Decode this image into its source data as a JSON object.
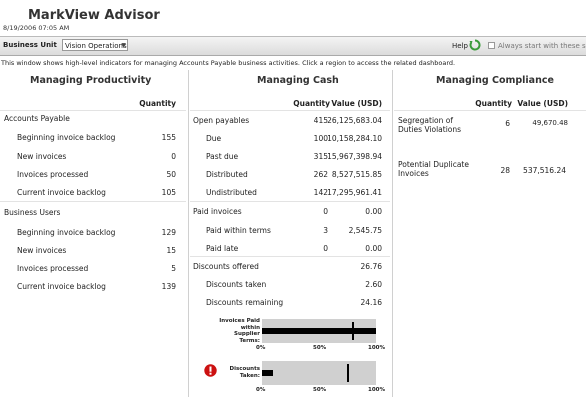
{
  "app": {
    "title": "MarkView Advisor",
    "timestamp": "8/19/2006 07:05 AM"
  },
  "toolbar": {
    "business_unit_label": "Business Unit",
    "business_unit_value": "Vision Operations",
    "help_label": "Help",
    "always_start_label": "Always start with these settings",
    "always_start_checked": false
  },
  "info_text": "This window shows high-level indicators for managing Accounts Payable business activities. Click a region to access the related dashboard.",
  "productivity": {
    "title": "Managing Productivity",
    "quantity_header": "Quantity",
    "groups": [
      {
        "label": "Accounts Payable",
        "rows": [
          {
            "label": "Beginning invoice backlog",
            "quantity": "155"
          },
          {
            "label": "New invoices",
            "quantity": "0"
          },
          {
            "label": "Invoices processed",
            "quantity": "50"
          },
          {
            "label": "Current invoice backlog",
            "quantity": "105"
          }
        ]
      },
      {
        "label": "Business Users",
        "rows": [
          {
            "label": "Beginning invoice backlog",
            "quantity": "129"
          },
          {
            "label": "New invoices",
            "quantity": "15"
          },
          {
            "label": "Invoices processed",
            "quantity": "5"
          },
          {
            "label": "Current invoice backlog",
            "quantity": "139"
          }
        ]
      }
    ]
  },
  "cash": {
    "title": "Managing Cash",
    "quantity_header": "Quantity",
    "value_header": "Value (USD)",
    "rows": [
      {
        "label": "Open payables",
        "quantity": "415",
        "value": "26,125,683.04",
        "indent": false
      },
      {
        "label": "Due",
        "quantity": "100",
        "value": "10,158,284.10",
        "indent": true
      },
      {
        "label": "Past due",
        "quantity": "315",
        "value": "15,967,398.94",
        "indent": true
      },
      {
        "label": "Distributed",
        "quantity": "262",
        "value": "8,527,515.85",
        "indent": true
      },
      {
        "label": "Undistributed",
        "quantity": "142",
        "value": "17,295,961.41",
        "indent": true
      },
      {
        "label": "Paid invoices",
        "quantity": "0",
        "value": "0.00",
        "indent": false
      },
      {
        "label": "Paid within terms",
        "quantity": "3",
        "value": "2,545.75",
        "indent": true
      },
      {
        "label": "Paid late",
        "quantity": "0",
        "value": "0.00",
        "indent": true
      },
      {
        "label": "Discounts offered",
        "quantity": "",
        "value": "26.76",
        "indent": false
      },
      {
        "label": "Discounts taken",
        "quantity": "",
        "value": "2.60",
        "indent": true
      },
      {
        "label": "Discounts remaining",
        "quantity": "",
        "value": "24.16",
        "indent": true
      }
    ],
    "gauges": [
      {
        "label_lines": [
          "Invoices Paid",
          "within",
          "Supplier",
          "Terms:"
        ],
        "fill_percent": 100,
        "marker_percent": 80,
        "alert": false,
        "ticks": [
          "0%",
          "50%",
          "100%"
        ],
        "colors": {
          "fill": "#000000",
          "background": "#d0d0d0",
          "marker": "#000000"
        }
      },
      {
        "label_lines": [
          "Discounts",
          "Taken:"
        ],
        "fill_percent": 10,
        "marker_percent": 75,
        "alert": true,
        "ticks": [
          "0%",
          "50%",
          "100%"
        ],
        "colors": {
          "fill": "#000000",
          "background": "#d0d0d0",
          "marker": "#000000",
          "alert": "#cc1111"
        }
      }
    ]
  },
  "compliance": {
    "title": "Managing Compliance",
    "quantity_header": "Quantity",
    "value_header": "Value (USD)",
    "rows": [
      {
        "label_lines": [
          "Segregation of",
          "Duties Violations"
        ],
        "quantity": "6",
        "value": "49,670.48"
      },
      {
        "label_lines": [
          "Potential Duplicate",
          "Invoices"
        ],
        "quantity": "28",
        "value": "537,516.24"
      }
    ]
  },
  "colors": {
    "accent_green": "#3a9a3a",
    "separator": "#d0d0d0",
    "toolbar": "#e4e4e4"
  }
}
